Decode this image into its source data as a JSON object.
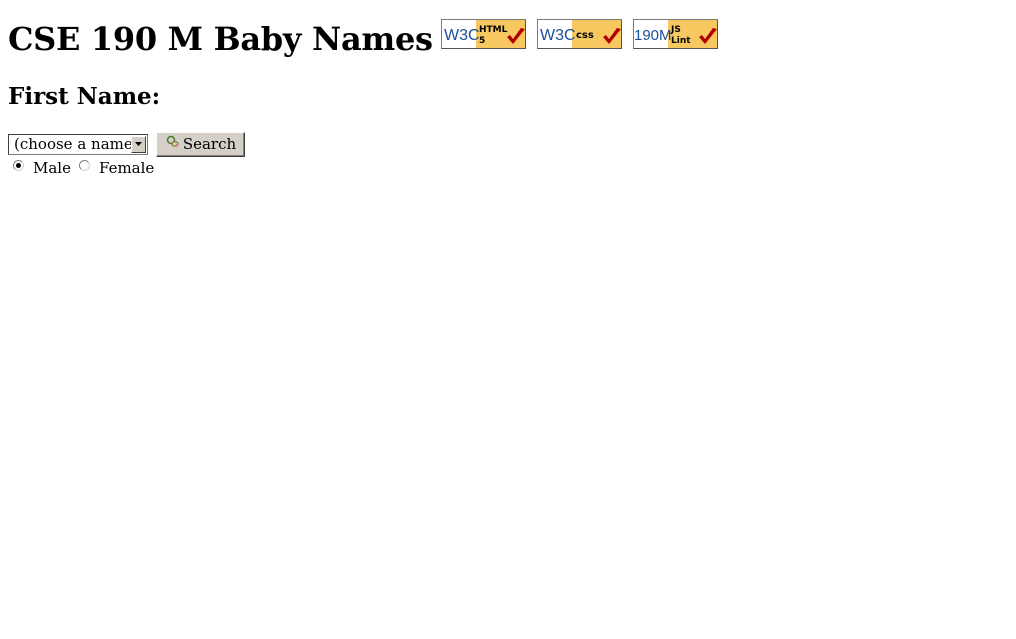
{
  "header": {
    "title": "CSE 190 M Baby Names",
    "badges": [
      {
        "icon": "w3c-html5-valid-icon",
        "left_text": "W3C",
        "right_text_line1": "HTML",
        "right_text_line2": "5"
      },
      {
        "icon": "w3c-css-valid-icon",
        "left_text": "W3C",
        "right_text_line1": "css",
        "right_text_line2": ""
      },
      {
        "icon": "jslint-valid-icon",
        "left_text": "190M",
        "right_text_line1": "JS",
        "right_text_line2": "Lint"
      }
    ]
  },
  "form": {
    "heading": "First Name:",
    "name_select": {
      "selected": "(choose a name)"
    },
    "search_button": {
      "label": "Search",
      "icon": "baby-pacifier-icon"
    },
    "gender": {
      "options": [
        {
          "label": "Male",
          "checked": true
        },
        {
          "label": "Female",
          "checked": false
        }
      ]
    }
  },
  "colors": {
    "badge_bg": "#f7c85f",
    "badge_left_bg": "#ffffff",
    "w3c_blue": "#1b4f9c",
    "check_red": "#b00000",
    "button_face": "#d4d0c8"
  }
}
